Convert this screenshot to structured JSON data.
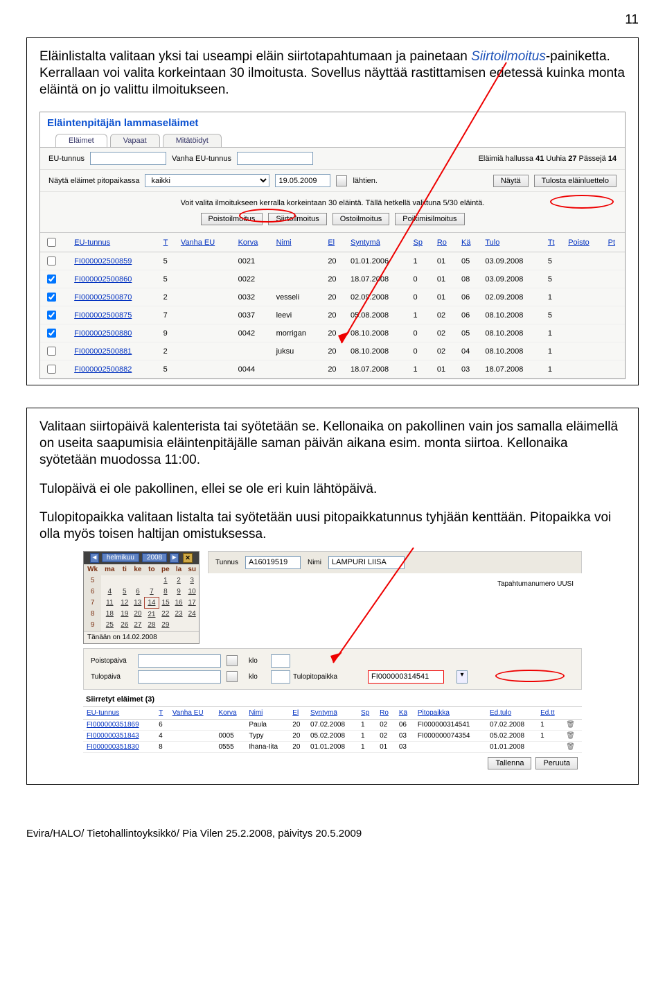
{
  "page_number": "11",
  "paragraph1": {
    "a": "Eläinlistalta valitaan yksi tai useampi eläin siirtotapahtumaan ja painetaan ",
    "emph": "Siirtoilmoitus",
    "b": "-painiketta. Kerrallaan voi valita korkeintaan 30 ilmoitusta. Sovellus näyttää rastittamisen edetessä kuinka monta eläintä on jo valittu ilmoitukseen."
  },
  "paragraph2": "Valitaan siirtopäivä kalenterista tai syötetään se. Kellonaika on pakollinen vain jos samalla eläimellä on useita saapumisia eläintenpitäjälle saman päivän aikana esim. monta siirtoa. Kellonaika syötetään muodossa 11:00.",
  "paragraph3": "Tulopäivä ei ole pakollinen, ellei se ole eri kuin lähtöpäivä.",
  "paragraph4": "Tulopitopaikka valitaan listalta tai syötetään uusi pitopaikkatunnus tyhjään kenttään. Pitopaikka voi olla myös toisen haltijan omistuksessa.",
  "shot1": {
    "title": "Eläintenpitäjän lammaseläimet",
    "tabs": [
      "Eläimet",
      "Vapaat",
      "Mitätöidyt"
    ],
    "filterRow": {
      "euLabel": "EU-tunnus",
      "oldEuLabel": "Vanha EU-tunnus",
      "countLabel": "Eläimiä hallussa",
      "count": "41",
      "uuhia": "Uuhia",
      "uuhiaN": "27",
      "passeja": "Pässejä",
      "passejaN": "14"
    },
    "showRow": {
      "label": "Näytä eläimet pitopaikassa",
      "select": "kaikki",
      "date": "19.05.2009",
      "suffix": "lähtien.",
      "btnShow": "Näytä",
      "btnPrint": "Tulosta eläinluettelo"
    },
    "notice": "Voit valita ilmoitukseen kerralla korkeintaan 30 eläintä. Tällä hetkellä valittuna 5/30 eläintä.",
    "noticeButtons": [
      "Poistoilmoitus",
      "Siirtoilmoitus",
      "Ostoilmoitus",
      "Poikimisilmoitus"
    ],
    "headers": [
      "",
      "EU-tunnus",
      "T",
      "Vanha EU",
      "Korva",
      "Nimi",
      "El",
      "Syntymä",
      "Sp",
      "Ro",
      "Kä",
      "Tulo",
      "Tt",
      "Poisto",
      "Pt"
    ],
    "rows": [
      {
        "cb": false,
        "eu": "FI000002500859",
        "t": "5",
        "old": "",
        "korva": "0021",
        "nimi": "",
        "el": "20",
        "synt": "01.01.2006",
        "sp": "1",
        "ro": "01",
        "ka": "05",
        "tulo": "03.09.2008",
        "tt": "5",
        "poisto": "",
        "pt": ""
      },
      {
        "cb": true,
        "eu": "FI000002500860",
        "t": "5",
        "old": "",
        "korva": "0022",
        "nimi": "",
        "el": "20",
        "synt": "18.07.2008",
        "sp": "0",
        "ro": "01",
        "ka": "08",
        "tulo": "03.09.2008",
        "tt": "5",
        "poisto": "",
        "pt": ""
      },
      {
        "cb": true,
        "eu": "FI000002500870",
        "t": "2",
        "old": "",
        "korva": "0032",
        "nimi": "vesseli",
        "el": "20",
        "synt": "02.09.2008",
        "sp": "0",
        "ro": "01",
        "ka": "06",
        "tulo": "02.09.2008",
        "tt": "1",
        "poisto": "",
        "pt": ""
      },
      {
        "cb": true,
        "eu": "FI000002500875",
        "t": "7",
        "old": "",
        "korva": "0037",
        "nimi": "leevi",
        "el": "20",
        "synt": "05.08.2008",
        "sp": "1",
        "ro": "02",
        "ka": "06",
        "tulo": "08.10.2008",
        "tt": "5",
        "poisto": "",
        "pt": ""
      },
      {
        "cb": true,
        "eu": "FI000002500880",
        "t": "9",
        "old": "",
        "korva": "0042",
        "nimi": "morrigan",
        "el": "20",
        "synt": "08.10.2008",
        "sp": "0",
        "ro": "02",
        "ka": "05",
        "tulo": "08.10.2008",
        "tt": "1",
        "poisto": "",
        "pt": ""
      },
      {
        "cb": false,
        "eu": "FI000002500881",
        "t": "2",
        "old": "",
        "korva": "",
        "nimi": "juksu",
        "el": "20",
        "synt": "08.10.2008",
        "sp": "0",
        "ro": "02",
        "ka": "04",
        "tulo": "08.10.2008",
        "tt": "1",
        "poisto": "",
        "pt": ""
      },
      {
        "cb": false,
        "eu": "FI000002500882",
        "t": "5",
        "old": "",
        "korva": "0044",
        "nimi": "",
        "el": "20",
        "synt": "18.07.2008",
        "sp": "1",
        "ro": "01",
        "ka": "03",
        "tulo": "18.07.2008",
        "tt": "1",
        "poisto": "",
        "pt": ""
      }
    ]
  },
  "shot2": {
    "cal": {
      "month": "helmikuu",
      "year": "2008",
      "dow": [
        "Wk",
        "ma",
        "ti",
        "ke",
        "to",
        "pe",
        "la",
        "su"
      ],
      "weeks": [
        [
          "5",
          "",
          "",
          "",
          "",
          "1",
          "2",
          "3"
        ],
        [
          "6",
          "4",
          "5",
          "6",
          "7",
          "8",
          "9",
          "10"
        ],
        [
          "7",
          "11",
          "12",
          "13",
          "14",
          "15",
          "16",
          "17"
        ],
        [
          "8",
          "18",
          "19",
          "20",
          "21",
          "22",
          "23",
          "24"
        ],
        [
          "9",
          "25",
          "26",
          "27",
          "28",
          "29",
          "",
          ""
        ]
      ],
      "footer": "Tänään on 14.02.2008"
    },
    "head": {
      "tunnusL": "Tunnus",
      "tunnusV": "A16019519",
      "nimiL": "Nimi",
      "nimiV": "LAMPURI LIISA"
    },
    "right": "Tapahtumanumero UUSI",
    "form": {
      "poistoL": "Poistopäivä",
      "tuloL": "Tulopäivä",
      "kloL": "klo",
      "tulopL": "Tulopitopaikka",
      "tulopV": "FI000000314541"
    },
    "t2title": "Siirretyt eläimet (3)",
    "headers2": [
      "EU-tunnus",
      "T",
      "Vanha EU",
      "Korva",
      "Nimi",
      "El",
      "Syntymä",
      "Sp",
      "Ro",
      "Kä",
      "Pitopaikka",
      "Ed.tulo",
      "Ed.tt",
      ""
    ],
    "rows2": [
      {
        "eu": "FI000000351869",
        "t": "6",
        "old": "",
        "korva": "",
        "nimi": "Paula",
        "el": "20",
        "synt": "07.02.2008",
        "sp": "1",
        "ro": "02",
        "ka": "06",
        "pp": "FI000000314541",
        "et": "07.02.2008",
        "ett": "1"
      },
      {
        "eu": "FI000000351843",
        "t": "4",
        "old": "",
        "korva": "0005",
        "nimi": "Typy",
        "el": "20",
        "synt": "05.02.2008",
        "sp": "1",
        "ro": "02",
        "ka": "03",
        "pp": "FI000000074354",
        "et": "05.02.2008",
        "ett": "1"
      },
      {
        "eu": "FI000000351830",
        "t": "8",
        "old": "",
        "korva": "0555",
        "nimi": "Ihana-Iita",
        "el": "20",
        "synt": "01.01.2008",
        "sp": "1",
        "ro": "01",
        "ka": "03",
        "pp": "",
        "et": "01.01.2008",
        "ett": ""
      }
    ],
    "btns": [
      "Tallenna",
      "Peruuta"
    ]
  },
  "footer_text": "Evira/HALO/ Tietohallintoyksikkö/ Pia Vilen 25.2.2008, päivitys 20.5.2009"
}
